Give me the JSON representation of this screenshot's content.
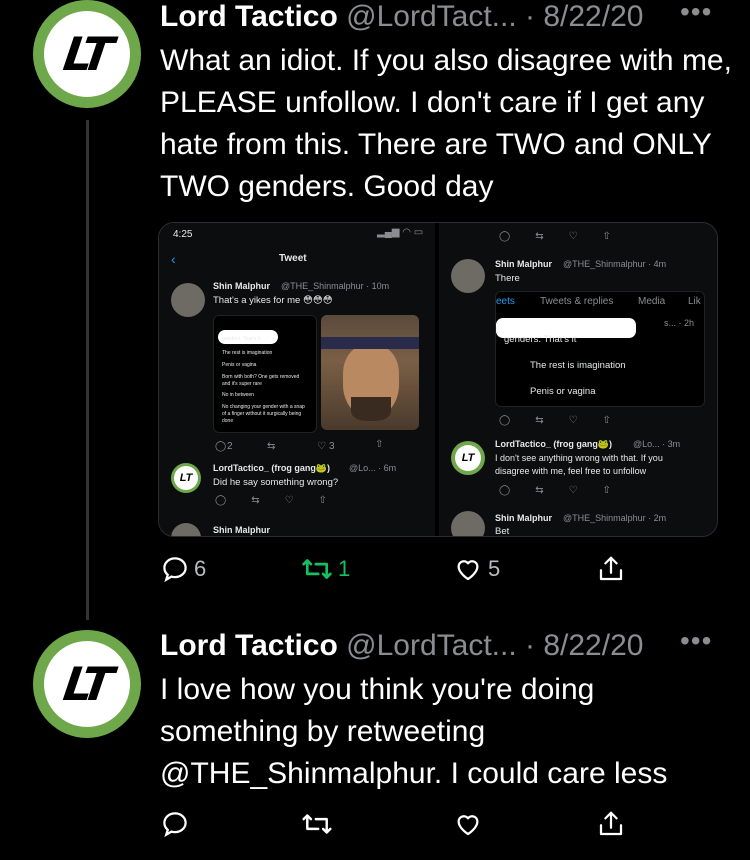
{
  "tweets": [
    {
      "avatar_initials": "LT",
      "name": "Lord Tactico",
      "handle": "@LordTact...",
      "separator": " · ",
      "date": "8/22/20",
      "more": "•••",
      "text": "What an idiot. If you also disagree with me, PLEASE unfollow. I don't care if I get any hate from this. There are TWO and ONLY TWO genders. Good day",
      "actions": {
        "reply_count": "6",
        "retweet_count": "1",
        "like_count": "5"
      }
    },
    {
      "avatar_initials": "LT",
      "name": "Lord Tactico",
      "handle": "@LordTact...",
      "separator": " · ",
      "date": "8/22/20",
      "more": "•••",
      "text": "I love how you think you're doing something by retweeting @THE_Shinmalphur. I could care less",
      "actions": {
        "reply_count": "",
        "retweet_count": "",
        "like_count": ""
      }
    }
  ],
  "media": {
    "left": {
      "time": "4:25",
      "title": "Tweet",
      "author": "Shin Malphur",
      "author_meta": "@THE_Shinmalphur · 10m",
      "text": "That's a yikes for me 😳😳😳",
      "inner_lines": [
        "genders. That's it",
        "The rest is imagination",
        "Penis or vagina",
        "Born with both? One gets removed",
        "and it's super rare",
        "No in between",
        "No changing your gender with a snap",
        "of a finger without it surgically being",
        "done"
      ],
      "inner_counts": {
        "reply": "2",
        "like": "3"
      },
      "reply_author": "LordTactico_ (frog gang🐸)",
      "reply_meta": "@Lo... · 6m",
      "reply_text": "Did he say something wrong?",
      "next_author": "Shin Malphur"
    },
    "right": {
      "top_author": "Shin Malphur",
      "top_meta": "@THE_Shinmalphur · 4m",
      "top_text": "There",
      "tabs": [
        "eets",
        "Tweets & replies",
        "Media",
        "Lik"
      ],
      "quote_meta": "s... · 2h",
      "quote_lines": [
        "genders. That's it",
        "The rest is imagination",
        "Penis or vagina"
      ],
      "reply_author": "LordTactico_ (frog gang🐸)",
      "reply_meta": "@Lo... · 3m",
      "reply_text_1": "I don't see anything wrong with that. If you",
      "reply_text_2": "disagree with me, feel free to unfollow",
      "bottom_author": "Shin Malphur",
      "bottom_meta": "@THE_Shinmalphur · 2m",
      "bottom_text": "Bet"
    }
  },
  "colors": {
    "background": "#000000",
    "text": "#ffffff",
    "meta": "#8a8d91",
    "retweet": "#17bf63",
    "avatar_ring": "#6fa84a"
  }
}
